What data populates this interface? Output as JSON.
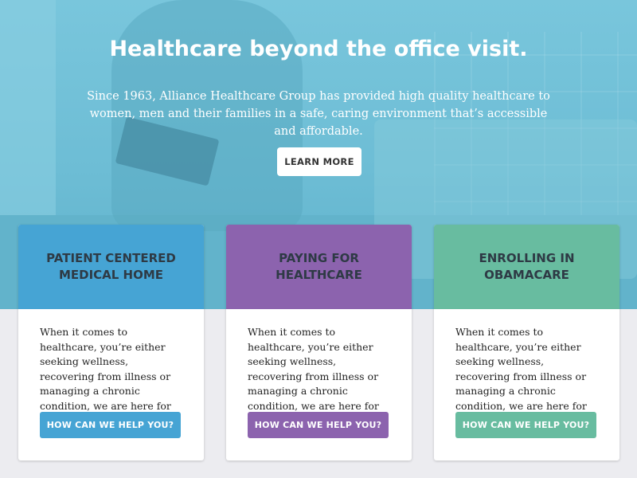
{
  "hero": {
    "title": "Healthcare beyond the office visit.",
    "subtitle": "Since 1963, Alliance Healthcare Group has provided high quality healthcare to women, men and their families in a safe, caring environment that’s accessible and affordable.",
    "button_label": "LEARN MORE"
  },
  "cards": [
    {
      "title": "PATIENT CENTERED MEDICAL HOME",
      "body": "When it comes to healthcare, you’re either seeking wellness, recovering from illness or managing a chronic condition, we are here for you lorem.",
      "button_label": "HOW CAN WE HELP YOU?"
    },
    {
      "title": "PAYING FOR HEALTHCARE",
      "body": "When it comes to healthcare, you’re either seeking wellness, recovering from illness or managing a chronic condition, we are here for you lorem.",
      "button_label": "HOW CAN WE HELP YOU?"
    },
    {
      "title": "ENROLLING IN OBAMACARE",
      "body": "When it comes to healthcare, you’re either seeking wellness, recovering from illness or managing a chronic condition, we are here for you lorem.",
      "button_label": "HOW CAN WE HELP YOU?"
    }
  ],
  "colors": {
    "hero_overlay": "#6cbcd4",
    "card_blue": "#46a4d4",
    "card_purple": "#8c63ae",
    "card_green": "#68bca0",
    "page_background": "#ececf0"
  }
}
